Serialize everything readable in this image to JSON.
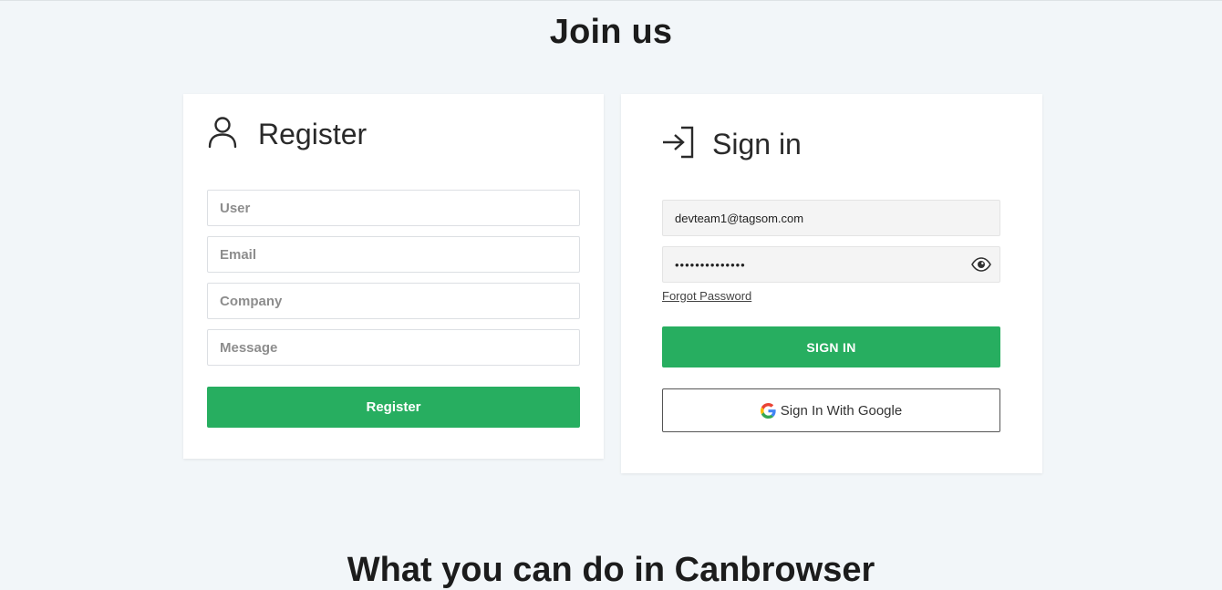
{
  "page": {
    "title": "Join us",
    "next_section_title": "What you can do in Canbrowser"
  },
  "register": {
    "title": "Register",
    "icon": "user-icon",
    "fields": {
      "user_placeholder": "User",
      "email_placeholder": "Email",
      "company_placeholder": "Company",
      "message_placeholder": "Message"
    },
    "button_label": "Register"
  },
  "signin": {
    "title": "Sign in",
    "icon": "sign-in-icon",
    "email_value": "devteam1@tagsom.com",
    "password_value": "••••••••••••••",
    "forgot_label": "Forgot Password",
    "button_label": "SIGN IN",
    "google_button_label": "Sign In With Google"
  },
  "colors": {
    "accent": "#27ae60",
    "background": "#f2f6f9",
    "card": "#ffffff"
  }
}
